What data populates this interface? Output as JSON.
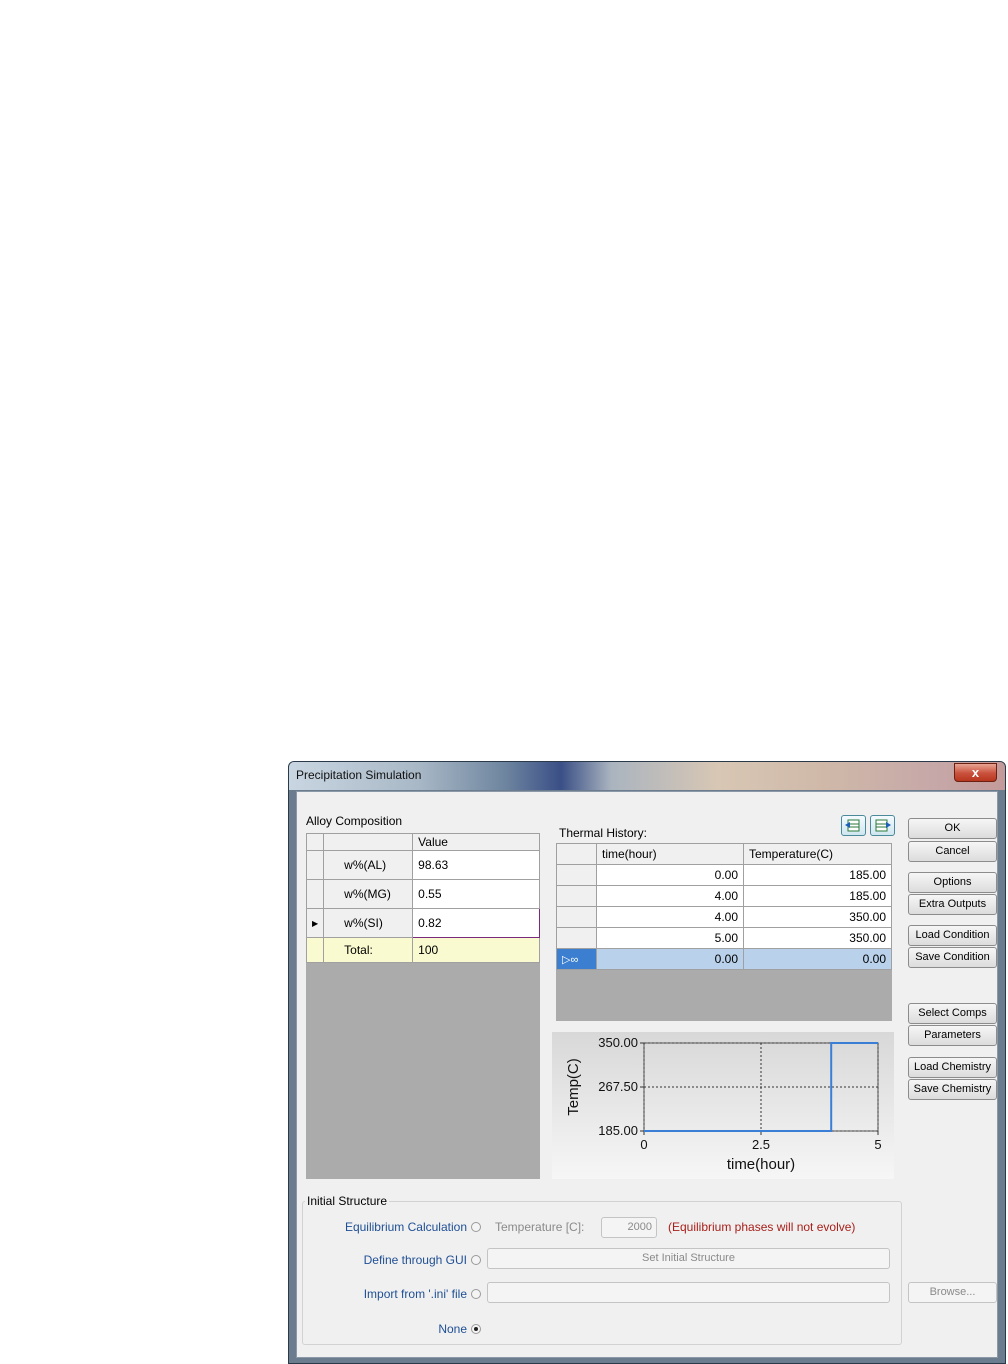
{
  "window": {
    "title": "Precipitation Simulation",
    "close_glyph": "x"
  },
  "alloy": {
    "group_label": "Alloy Composition",
    "value_header": "Value",
    "rows": [
      {
        "name": "w%(AL)",
        "value": "98.63"
      },
      {
        "name": "w%(MG)",
        "value": "0.55"
      },
      {
        "name": "w%(SI)",
        "value": "0.82"
      }
    ],
    "total_label": "Total:",
    "total_value": "100"
  },
  "thermal": {
    "label": "Thermal History:",
    "col_time": "time(hour)",
    "col_temp": "Temperature(C)",
    "rows": [
      {
        "time": "0.00",
        "temp": "185.00"
      },
      {
        "time": "4.00",
        "temp": "185.00"
      },
      {
        "time": "4.00",
        "temp": "350.00"
      },
      {
        "time": "5.00",
        "temp": "350.00"
      },
      {
        "time": "0.00",
        "temp": "0.00"
      }
    ]
  },
  "chart_data": {
    "type": "line",
    "xlabel": "time(hour)",
    "ylabel": "Temp(C)",
    "xlim": [
      0,
      5
    ],
    "ylim": [
      185,
      350
    ],
    "x_ticks": [
      "0",
      "2.5",
      "5"
    ],
    "y_ticks": [
      "350.00",
      "267.50",
      "185.00"
    ],
    "grid": true,
    "series": [
      {
        "x": [
          0,
          4,
          4,
          5
        ],
        "y": [
          185,
          185,
          350,
          350
        ],
        "color": "#3a7fd5"
      }
    ]
  },
  "buttons": {
    "ok": "OK",
    "cancel": "Cancel",
    "options": "Options",
    "extra_outputs": "Extra Outputs",
    "load_condition": "Load Condition",
    "save_condition": "Save Condition",
    "select_comps": "Select Comps",
    "parameters": "Parameters",
    "load_chemistry": "Load Chemistry",
    "save_chemistry": "Save Chemistry",
    "browse": "Browse..."
  },
  "initial_structure": {
    "group_label": "Initial Structure",
    "eq_calc_label": "Equilibrium Calculation",
    "temp_label": "Temperature [C]:",
    "temp_value": "2000",
    "eq_note": "(Equilibrium phases will not evolve)",
    "gui_label": "Define through GUI",
    "set_initial_label": "Set Initial Structure",
    "ini_label": "Import from '.ini' file",
    "none_label": "None"
  },
  "colors": {
    "note_red": "#a8201a",
    "label_blue": "#1f4f95",
    "selected_row": "#b9d1ea"
  }
}
